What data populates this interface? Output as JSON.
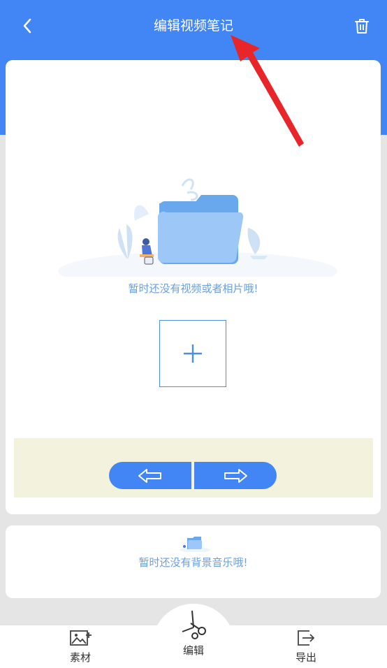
{
  "header": {
    "title": "编辑视频笔记",
    "back_icon": "chevron-left-icon",
    "delete_icon": "trash-icon",
    "color": "#4285f4"
  },
  "media": {
    "empty_text": "暂时还没有视频或者相片哦!",
    "add_icon": "plus-icon",
    "prev_icon": "arrow-left-icon",
    "next_icon": "arrow-right-icon"
  },
  "music": {
    "empty_text": "暂时还没有背景音乐哦!"
  },
  "tabbar": {
    "items": [
      {
        "label": "素材",
        "icon": "image-add-icon"
      },
      {
        "label": "编辑",
        "icon": "scissors-icon"
      },
      {
        "label": "导出",
        "icon": "export-icon"
      }
    ]
  },
  "annotation_color": "#e8262a"
}
